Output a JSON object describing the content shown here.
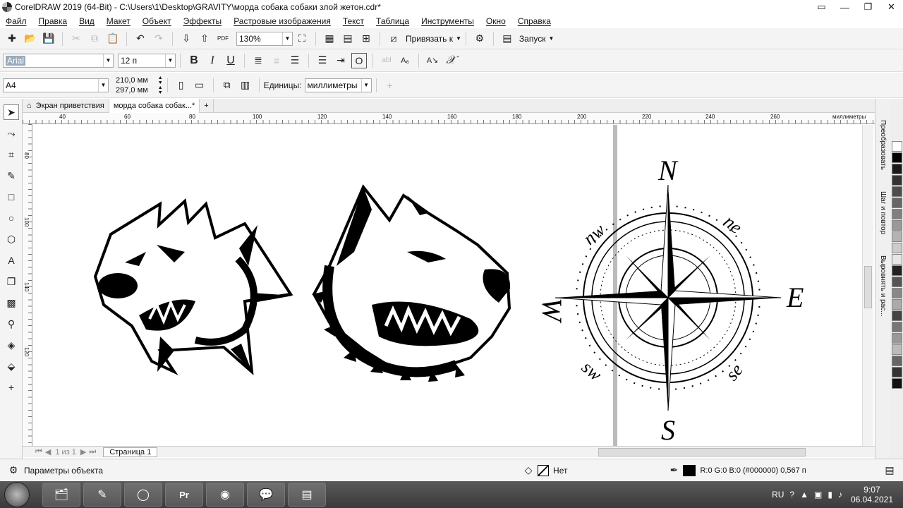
{
  "window": {
    "title": "CorelDRAW 2019 (64-Bit) - C:\\Users\\1\\Desktop\\GRAVITY\\морда собака собаки злой жетон.cdr*"
  },
  "menu": [
    "Файл",
    "Правка",
    "Вид",
    "Макет",
    "Объект",
    "Эффекты",
    "Растровые изображения",
    "Текст",
    "Таблица",
    "Инструменты",
    "Окно",
    "Справка"
  ],
  "toolbar1": {
    "zoom": "130%",
    "snap_label": "Привязать к",
    "launch_label": "Запуск"
  },
  "toolbar2": {
    "font_name": "Arial",
    "font_size": "12 п"
  },
  "toolbar3": {
    "page_size": "A4",
    "width": "210,0 мм",
    "height": "297,0 мм",
    "units_label": "Единицы:",
    "units_value": "миллиметры"
  },
  "tabs": [
    {
      "label": "Экран приветствия"
    },
    {
      "label": "морда собака собак...*"
    }
  ],
  "ruler": {
    "h_ticks": [
      "40",
      "60",
      "80",
      "100",
      "120",
      "140",
      "160",
      "180",
      "200",
      "220",
      "240",
      "260"
    ],
    "h_unit": "миллиметры",
    "v_ticks": [
      "80",
      "100",
      "140",
      "120"
    ]
  },
  "compass": {
    "n": "N",
    "s": "S",
    "e": "E",
    "w": "W",
    "ne": "ne",
    "nw": "nw",
    "se": "se",
    "sw": "sw"
  },
  "pages": {
    "info": "1 из 1",
    "page_tab": "Страница 1"
  },
  "dockers": [
    "Преобразовать",
    "Шаг и повтор",
    "Выровнять и рас..."
  ],
  "status": {
    "object_params": "Параметры объекта",
    "fill": "Нет",
    "outline": "R:0 G:0 B:0 (#000000)  0,567 п"
  },
  "palette": [
    "#ffffff",
    "#000000",
    "#1a1a1a",
    "#333333",
    "#4d4d4d",
    "#666666",
    "#808080",
    "#999999",
    "#b3b3b3",
    "#cccccc",
    "#e6e6e6",
    "#222222",
    "#555555",
    "#888888",
    "#aaaaaa",
    "#444444",
    "#777777",
    "#999999",
    "#bbbbbb",
    "#666666",
    "#333333",
    "#111111"
  ],
  "taskbar": {
    "lang": "RU",
    "time": "9:07",
    "date": "06.04.2021"
  }
}
